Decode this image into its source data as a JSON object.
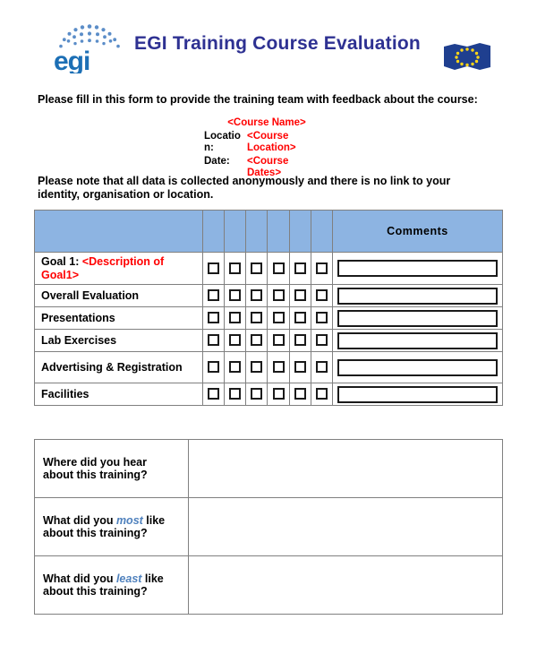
{
  "document": {
    "logo_alt": "EGI logo",
    "title": "EGI Training Course Evaluation",
    "flag_alt": "European Union flag",
    "intro": "Please fill in this form to provide the training team with feedback about the course:",
    "note": "Please note that all data is collected anonymously and there is no link to your identity, organisation or location."
  },
  "course": {
    "name": "<Course Name>",
    "location_label": "Locatio n:",
    "location_value": "<Course Location>",
    "date_label": "Date:",
    "date_value": "<Course Dates>"
  },
  "evaluation_table": {
    "comments_header": "Comments",
    "rating_columns": 6,
    "rows": [
      {
        "label_black": "Goal 1: ",
        "label_red": "<Description of Goal1>",
        "tall": true
      },
      {
        "label_black": "Overall Evaluation",
        "label_red": "",
        "tall": false
      },
      {
        "label_black": "Presentations",
        "label_red": "",
        "tall": false
      },
      {
        "label_black": "Lab Exercises",
        "label_red": "",
        "tall": false
      },
      {
        "label_black": "Advertising & Registration",
        "label_red": "",
        "tall": true
      },
      {
        "label_black": "Facilities",
        "label_red": "",
        "tall": false
      }
    ]
  },
  "questions_table": {
    "rows": [
      {
        "pre": "Where did you hear",
        "em": "",
        "post": "",
        "line2": "about this training?"
      },
      {
        "pre": "What did you ",
        "em": "most",
        "post": " like",
        "line2": "about this training?"
      },
      {
        "pre": "What did you ",
        "em": "least",
        "post": " like",
        "line2": "about this training?"
      }
    ]
  },
  "colors": {
    "title": "#2E3192",
    "header_fill": "#8DB4E2",
    "placeholder_red": "#FF0000",
    "emphasis_blue": "#4F81BD",
    "border": "#808080"
  }
}
